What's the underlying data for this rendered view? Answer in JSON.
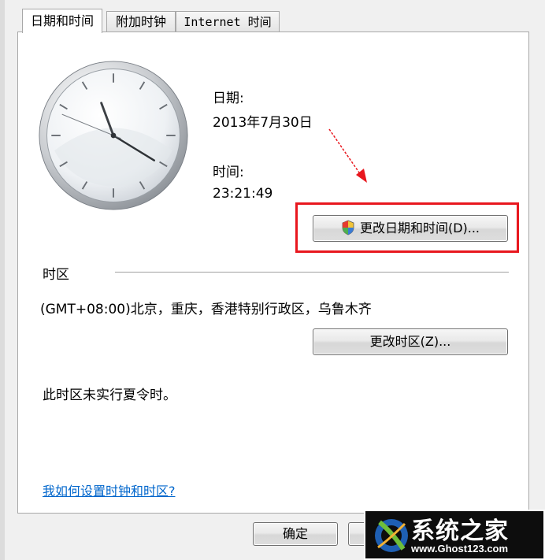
{
  "tabs": [
    {
      "label": "日期和时间"
    },
    {
      "label": "附加时钟"
    },
    {
      "label": "Internet 时间"
    }
  ],
  "date": {
    "label": "日期:",
    "value": "2013年7月30日"
  },
  "time": {
    "label": "时间:",
    "value": "23:21:49"
  },
  "change_datetime_button": "更改日期和时间(D)...",
  "timezone": {
    "section_label": "时区",
    "value": "(GMT+08:00)北京，重庆，香港特别行政区，乌鲁木齐",
    "change_button": "更改时区(Z)...",
    "dst_note": "此时区未实行夏令时。"
  },
  "help_link": "我如何设置时钟和时区?",
  "footer": {
    "ok_label": "确定"
  },
  "watermark": {
    "title": "系统之家",
    "url": "www.Ghost123.com"
  },
  "colors": {
    "highlight": "#e8171e",
    "link": "#0066cc",
    "arrow": "#e8171e"
  },
  "icons": [
    "shield-icon",
    "analog-clock",
    "red-arrow"
  ]
}
